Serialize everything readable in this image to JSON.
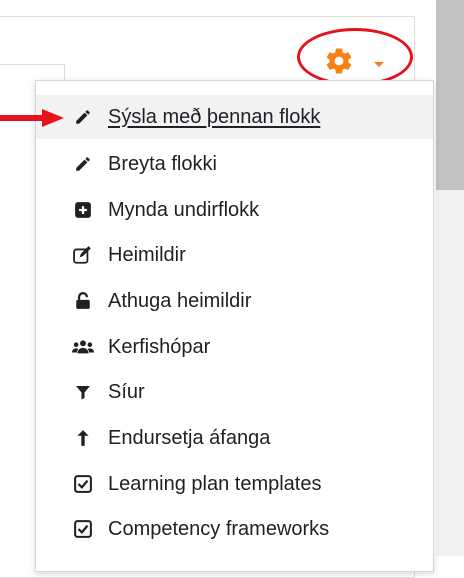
{
  "menu": {
    "items": [
      {
        "label": "Sýsla með þennan flokk",
        "icon": "pencil-icon"
      },
      {
        "label": "Breyta flokki",
        "icon": "pencil-icon"
      },
      {
        "label": "Mynda undirflokk",
        "icon": "plus-square-icon"
      },
      {
        "label": "Heimildir",
        "icon": "edit-square-icon"
      },
      {
        "label": "Athuga heimildir",
        "icon": "unlock-icon"
      },
      {
        "label": "Kerfishópar",
        "icon": "users-icon"
      },
      {
        "label": "Síur",
        "icon": "filter-icon"
      },
      {
        "label": "Endursetja áfanga",
        "icon": "level-up-icon"
      },
      {
        "label": "Learning plan templates",
        "icon": "check-square-icon"
      },
      {
        "label": "Competency frameworks",
        "icon": "check-square-icon"
      }
    ]
  },
  "colors": {
    "gear": "#f98012",
    "highlight": "#e5131e",
    "text": "#1d2125",
    "active_bg": "#f2f2f2"
  },
  "annotation": {
    "highlight_target": "settings-gear-menu",
    "arrow_target": "menu-item-0"
  }
}
